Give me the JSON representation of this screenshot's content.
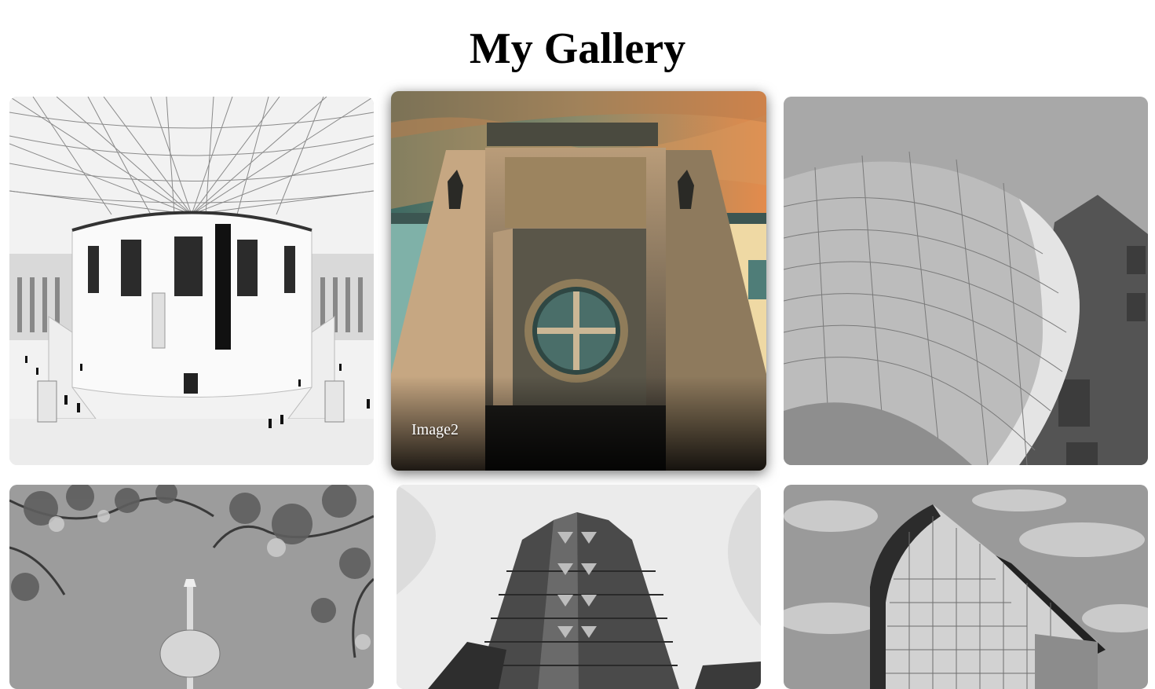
{
  "page": {
    "title": "My Gallery"
  },
  "gallery": {
    "items": [
      {
        "id": "Image1",
        "caption": "",
        "icon": "museum-rotunda-photo",
        "tone": "grayscale"
      },
      {
        "id": "Image2",
        "caption": "Image2",
        "icon": "round-window-building-photo",
        "tone": "color",
        "active": true
      },
      {
        "id": "Image3",
        "caption": "",
        "icon": "curved-metal-facade-photo",
        "tone": "grayscale"
      },
      {
        "id": "Image4",
        "caption": "",
        "icon": "tv-tower-branches-photo",
        "tone": "grayscale"
      },
      {
        "id": "Image5",
        "caption": "",
        "icon": "skyscraper-photo",
        "tone": "grayscale"
      },
      {
        "id": "Image6",
        "caption": "",
        "icon": "glass-office-building-photo",
        "tone": "grayscale"
      }
    ]
  },
  "colors": {
    "background": "#ffffff",
    "caption_text": "#ffffff",
    "title_text": "#000000"
  }
}
